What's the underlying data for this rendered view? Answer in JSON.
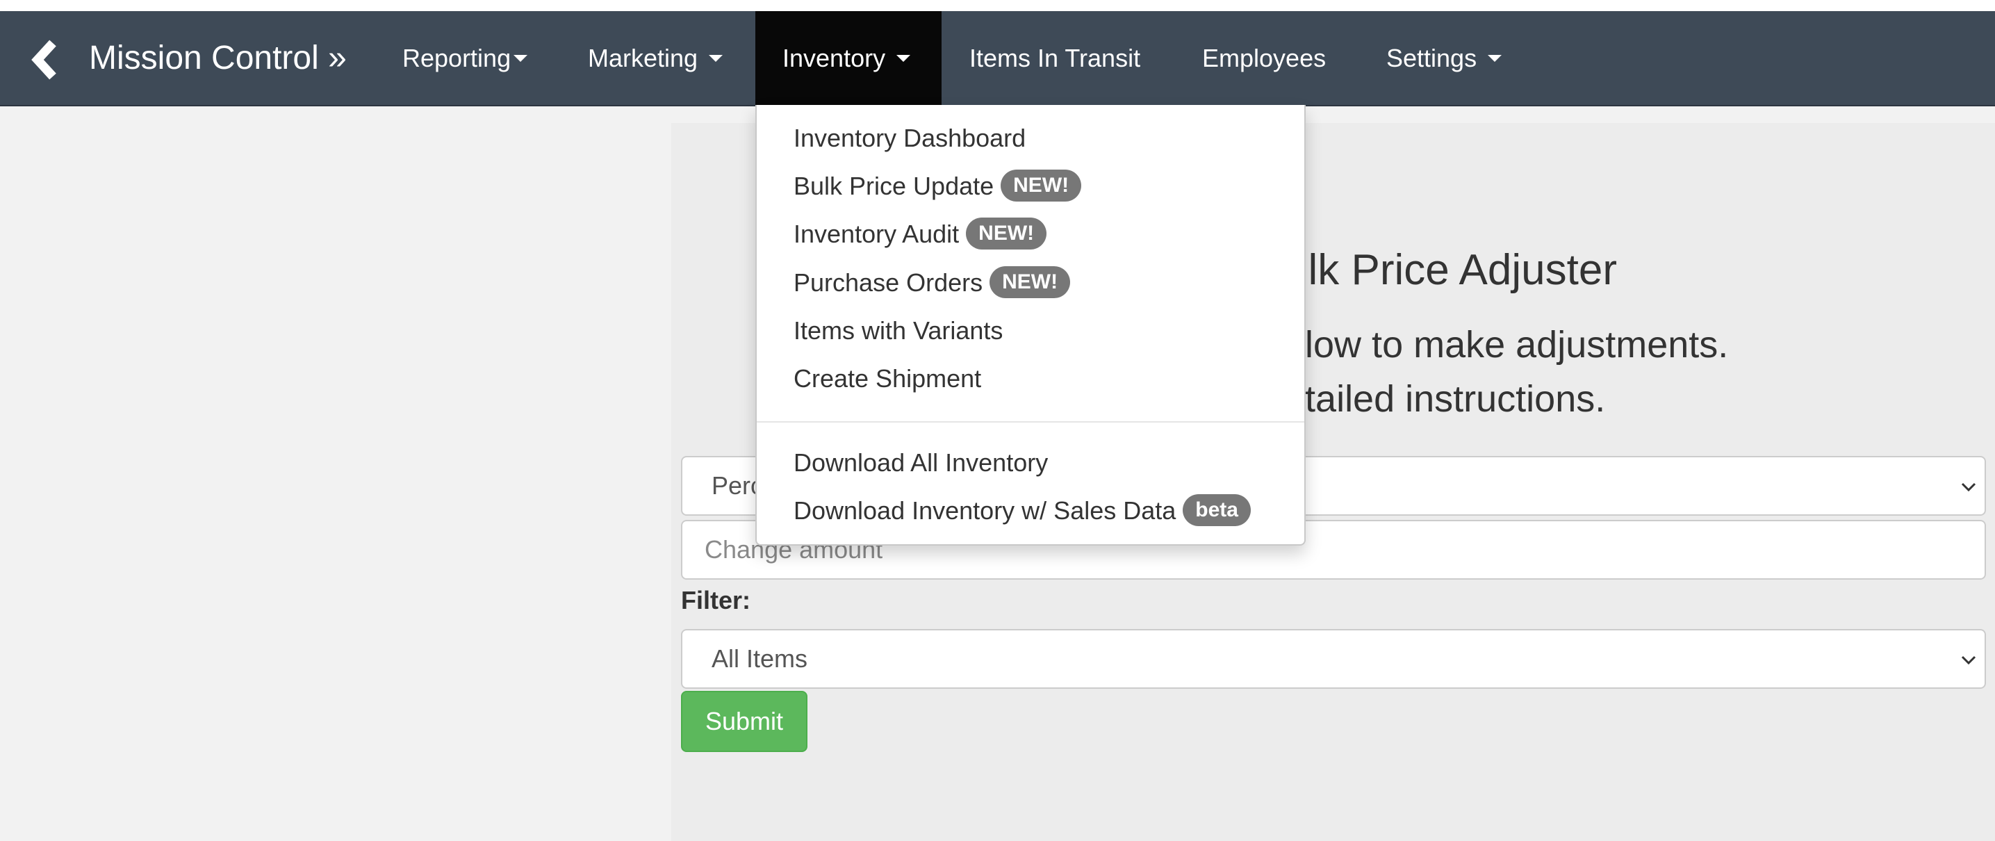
{
  "navbar": {
    "brand": "Mission Control »",
    "items": [
      {
        "label": "Reporting",
        "has_caret": true
      },
      {
        "label": "Marketing",
        "has_caret": true
      },
      {
        "label": "Inventory",
        "has_caret": true,
        "active": true
      },
      {
        "label": "Items In Transit",
        "has_caret": false
      },
      {
        "label": "Employees",
        "has_caret": false
      },
      {
        "label": "Settings",
        "has_caret": true
      }
    ],
    "icons": {
      "back": "chevron-left-icon",
      "caret": "caret-down-icon"
    }
  },
  "inventory_menu": {
    "items": [
      {
        "label": "Inventory Dashboard"
      },
      {
        "label": "Bulk Price Update",
        "badge": "NEW!"
      },
      {
        "label": "Inventory Audit",
        "badge": "NEW!"
      },
      {
        "label": "Purchase Orders",
        "badge": "NEW!"
      },
      {
        "label": "Items with Variants"
      },
      {
        "label": "Create Shipment"
      },
      {
        "label": "Download All Inventory"
      },
      {
        "label": "Download Inventory w/ Sales Data",
        "badge": "beta"
      }
    ]
  },
  "main": {
    "title_visible": "ulk Price Adjuster",
    "instruction_line1_visible": "elow to make adjustments.",
    "instruction_line2_visible": "etailed instructions.",
    "adjust_type_select": {
      "selected_visible": "Perc"
    },
    "change_amount": {
      "placeholder": "Change amount",
      "value": ""
    },
    "filter_label": "Filter:",
    "filter_select": {
      "selected": "All Items"
    },
    "submit_label": "Submit"
  },
  "colors": {
    "navbar_bg": "#3e4a57",
    "active_tab_bg": "#080808",
    "badge_bg": "#777777",
    "submit_bg": "#5cb85c",
    "page_bg": "#f2f2f2",
    "panel_bg": "#ececec"
  }
}
